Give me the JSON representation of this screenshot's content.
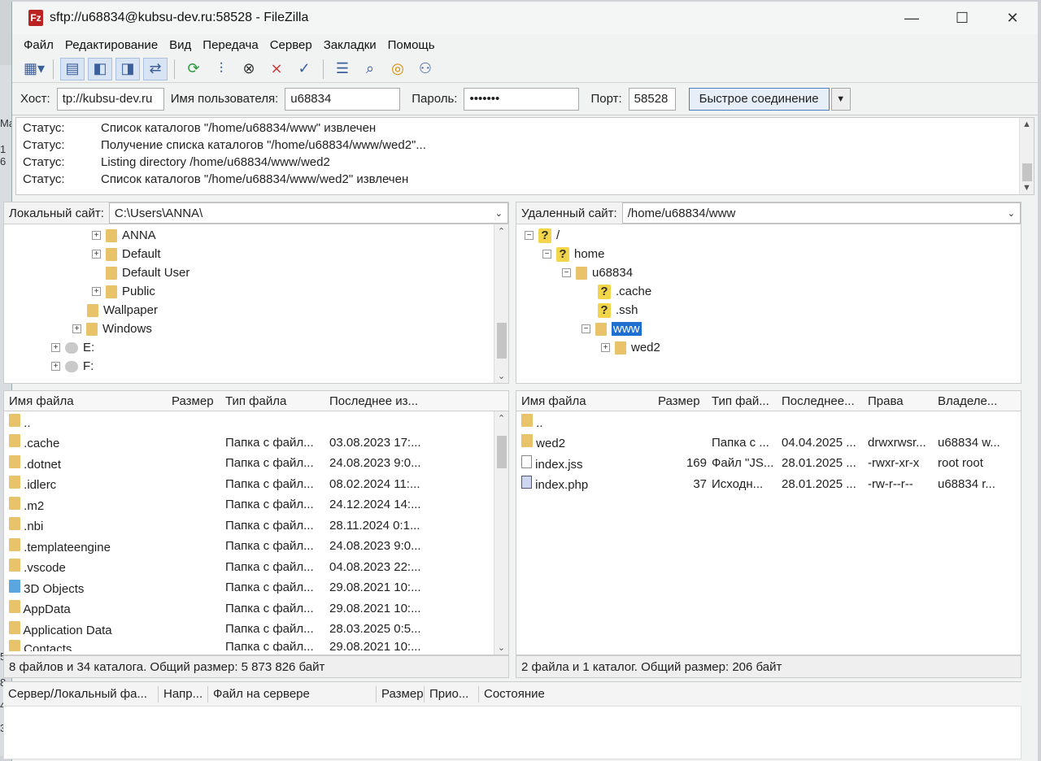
{
  "window": {
    "title": "sftp://u68834@kubsu-dev.ru:58528 - FileZilla",
    "app_icon": "Fz",
    "controls": [
      "—",
      "☐",
      "✕"
    ]
  },
  "menu": [
    "Файл",
    "Редактирование",
    "Вид",
    "Передача",
    "Сервер",
    "Закладки",
    "Помощь"
  ],
  "quickconnect": {
    "host_label": "Хост:",
    "host_value": "tp://kubsu-dev.ru",
    "user_label": "Имя пользователя:",
    "user_value": "u68834",
    "pass_label": "Пароль:",
    "pass_value": "•••••••",
    "port_label": "Порт:",
    "port_value": "58528",
    "connect_label": "Быстрое соединение"
  },
  "log": [
    {
      "label": "Статус:",
      "text": "Список каталогов \"/home/u68834/www\" извлечен"
    },
    {
      "label": "Статус:",
      "text": "Получение списка каталогов \"/home/u68834/www/wed2\"..."
    },
    {
      "label": "Статус:",
      "text": "Listing directory /home/u68834/www/wed2"
    },
    {
      "label": "Статус:",
      "text": "Список каталогов \"/home/u68834/www/wed2\" извлечен"
    }
  ],
  "local": {
    "site_label": "Локальный сайт:",
    "path": "C:\\Users\\ANNA\\",
    "tree": [
      "ANNA",
      "Default",
      "Default User",
      "Public",
      "Wallpaper",
      "Windows",
      "E:",
      "F:"
    ],
    "columns": [
      "Имя файла",
      "Размер",
      "Тип файла",
      "Последнее из..."
    ],
    "files": [
      {
        "name": "..",
        "size": "",
        "type": "",
        "modified": ""
      },
      {
        "name": ".cache",
        "size": "",
        "type": "Папка с файл...",
        "modified": "03.08.2023 17:..."
      },
      {
        "name": ".dotnet",
        "size": "",
        "type": "Папка с файл...",
        "modified": "24.08.2023 9:0..."
      },
      {
        "name": ".idlerc",
        "size": "",
        "type": "Папка с файл...",
        "modified": "08.02.2024 11:..."
      },
      {
        "name": ".m2",
        "size": "",
        "type": "Папка с файл...",
        "modified": "24.12.2024 14:..."
      },
      {
        "name": ".nbi",
        "size": "",
        "type": "Папка с файл...",
        "modified": "28.11.2024 0:1..."
      },
      {
        "name": ".templateengine",
        "size": "",
        "type": "Папка с файл...",
        "modified": "24.08.2023 9:0..."
      },
      {
        "name": ".vscode",
        "size": "",
        "type": "Папка с файл...",
        "modified": "04.08.2023 22:..."
      },
      {
        "name": "3D Objects",
        "size": "",
        "type": "Папка с файл...",
        "modified": "29.08.2021 10:..."
      },
      {
        "name": "AppData",
        "size": "",
        "type": "Папка с файл...",
        "modified": "29.08.2021 10:..."
      },
      {
        "name": "Application Data",
        "size": "",
        "type": "Папка с файл...",
        "modified": "28.03.2025 0:5..."
      },
      {
        "name": "Contacts",
        "size": "",
        "type": "Папка с файл...",
        "modified": "29.08.2021 10:..."
      }
    ],
    "status": "8 файлов и 34 каталога. Общий размер: 5 873 826 байт"
  },
  "remote": {
    "site_label": "Удаленный сайт:",
    "path": "/home/u68834/www",
    "tree": [
      "/",
      "home",
      "u68834",
      ".cache",
      ".ssh",
      "www",
      "wed2"
    ],
    "columns": [
      "Имя файла",
      "Размер",
      "Тип фай...",
      "Последнее...",
      "Права",
      "Владеле..."
    ],
    "files": [
      {
        "name": "..",
        "size": "",
        "type": "",
        "modified": "",
        "perms": "",
        "owner": ""
      },
      {
        "name": "wed2",
        "size": "",
        "type": "Папка с ...",
        "modified": "04.04.2025 ...",
        "perms": "drwxrwsr...",
        "owner": "u68834 w..."
      },
      {
        "name": "index.jss",
        "size": "169",
        "type": "Файл \"JS...",
        "modified": "28.01.2025 ...",
        "perms": "-rwxr-xr-x",
        "owner": "root root"
      },
      {
        "name": "index.php",
        "size": "37",
        "type": "Исходн...",
        "modified": "28.01.2025 ...",
        "perms": "-rw-r--r--",
        "owner": "u68834 r..."
      }
    ],
    "status": "2 файла и 1 каталог. Общий размер: 206 байт"
  },
  "queue": {
    "columns": [
      "Сервер/Локальный фа...",
      "Напр...",
      "Файл на сервере",
      "Размер",
      "Прио...",
      "Состояние"
    ]
  },
  "side_strip": [
    "Mac",
    "1 6",
    "5",
    "8",
    "4",
    "3"
  ]
}
